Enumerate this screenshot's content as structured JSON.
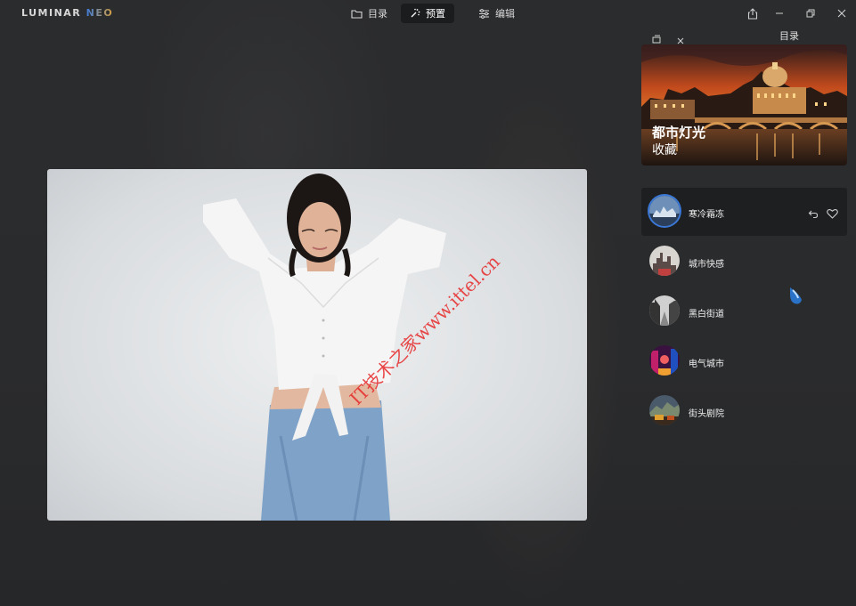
{
  "app": {
    "logo_main": "LUMINAR ",
    "logo_accent": "NEO"
  },
  "nav": {
    "catalog": "目录",
    "presets": "预置",
    "edit": "编辑",
    "active": "presets"
  },
  "watermark": "IT技术之家www.ittel.cn",
  "panel": {
    "title": "目录",
    "collection": {
      "title": "都市灯光",
      "subtitle": "收藏"
    },
    "presets": [
      {
        "label": "寒冷霜冻",
        "selected": true
      },
      {
        "label": "城市快感",
        "selected": false
      },
      {
        "label": "黑白街道",
        "selected": false
      },
      {
        "label": "电气城市",
        "selected": false
      },
      {
        "label": "街头剧院",
        "selected": false
      }
    ]
  },
  "colors": {
    "accent": "#3a78d8",
    "background": "#2a2b2d",
    "selected_row": "#1e1f21"
  }
}
